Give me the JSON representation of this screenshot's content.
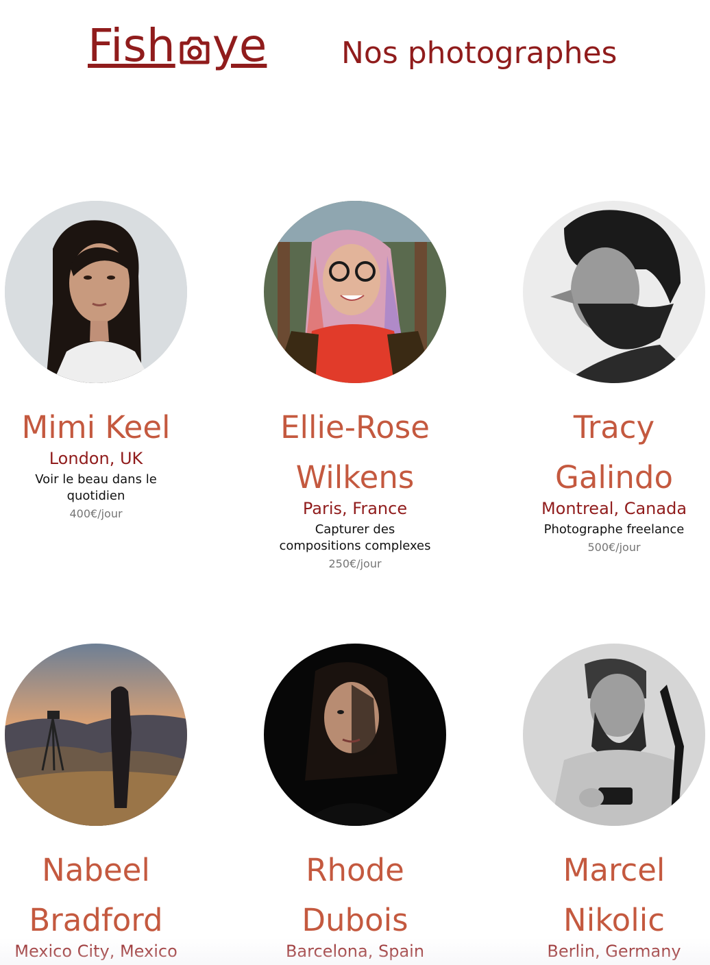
{
  "header": {
    "logo_before": "Fish",
    "logo_after": "ye",
    "title": "Nos photographes"
  },
  "colors": {
    "brand": "#901c1c",
    "name": "#c4593f",
    "price": "#757575"
  },
  "photographers": [
    {
      "name": "Mimi Keel",
      "location": "London, UK",
      "tagline": "Voir le beau dans le quotidien",
      "price": "400€/jour"
    },
    {
      "name": "Ellie-Rose Wilkens",
      "location": "Paris, France",
      "tagline": "Capturer des compositions complexes",
      "price": "250€/jour"
    },
    {
      "name": "Tracy Galindo",
      "location": "Montreal, Canada",
      "tagline": "Photographe freelance",
      "price": "500€/jour"
    },
    {
      "name": "Nabeel Bradford",
      "location": "Mexico City, Mexico"
    },
    {
      "name": "Rhode Dubois",
      "location": "Barcelona, Spain"
    },
    {
      "name": "Marcel Nikolic",
      "location": "Berlin, Germany"
    }
  ]
}
